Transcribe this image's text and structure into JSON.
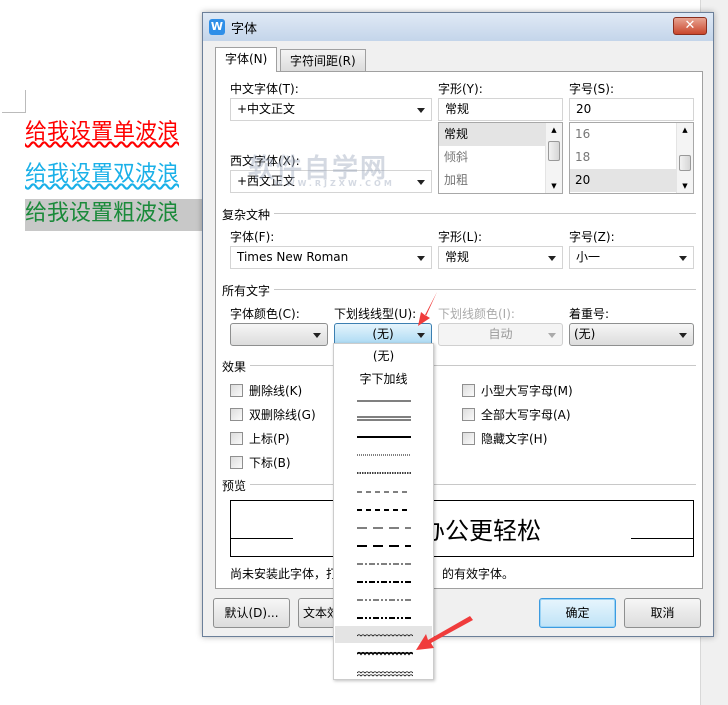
{
  "document": {
    "lines": [
      "给我设置单波浪",
      "给我设置双波浪",
      "给我设置粗波浪"
    ]
  },
  "dialog": {
    "title": "字体",
    "close": "✕",
    "logo": "W",
    "tabs": [
      "字体(N)",
      "字符间距(R)"
    ],
    "chinese_font": {
      "label": "中文字体(T):",
      "value": "+中文正文"
    },
    "western_font": {
      "label": "西文字体(X):",
      "value": "+西文正文"
    },
    "style": {
      "label": "字形(Y):",
      "value": "常规",
      "options": [
        "常规",
        "倾斜",
        "加粗"
      ]
    },
    "size": {
      "label": "字号(S):",
      "value": "20",
      "options": [
        "16",
        "18",
        "20"
      ]
    },
    "complex": {
      "section": "复杂文种",
      "font_label": "字体(F):",
      "font_value": "Times New Roman",
      "style_label": "字形(L):",
      "style_value": "常规",
      "size_label": "字号(Z):",
      "size_value": "小一"
    },
    "all_text": {
      "section": "所有文字",
      "color_label": "字体颜色(C):",
      "underline_label": "下划线线型(U):",
      "underline_value": "(无)",
      "ucolor_label": "下划线颜色(I):",
      "ucolor_value": "自动",
      "emphasis_label": "着重号:",
      "emphasis_value": "(无)"
    },
    "effects": {
      "section": "效果",
      "left": [
        "删除线(K)",
        "双删除线(G)",
        "上标(P)",
        "下标(B)"
      ],
      "right": [
        "小型大写字母(M)",
        "全部大写字母(A)",
        "隐藏文字(H)"
      ]
    },
    "preview": {
      "section": "预览",
      "text": "办公更轻松",
      "note_left": "尚未安装此字体，打",
      "note_right": "的有效字体。"
    },
    "buttons": {
      "default": "默认(D)...",
      "text_effect": "文本效",
      "ok": "确定",
      "cancel": "取消"
    },
    "underline_dropdown": {
      "text_items": [
        "(无)",
        "字下加线"
      ],
      "selected_index": 14
    },
    "watermark": {
      "main": "软件自学网",
      "sub": "WWW.RJZXW.COM"
    },
    "colors": {
      "accent": "#3c9be0",
      "arrow": "#f03c3c"
    }
  }
}
